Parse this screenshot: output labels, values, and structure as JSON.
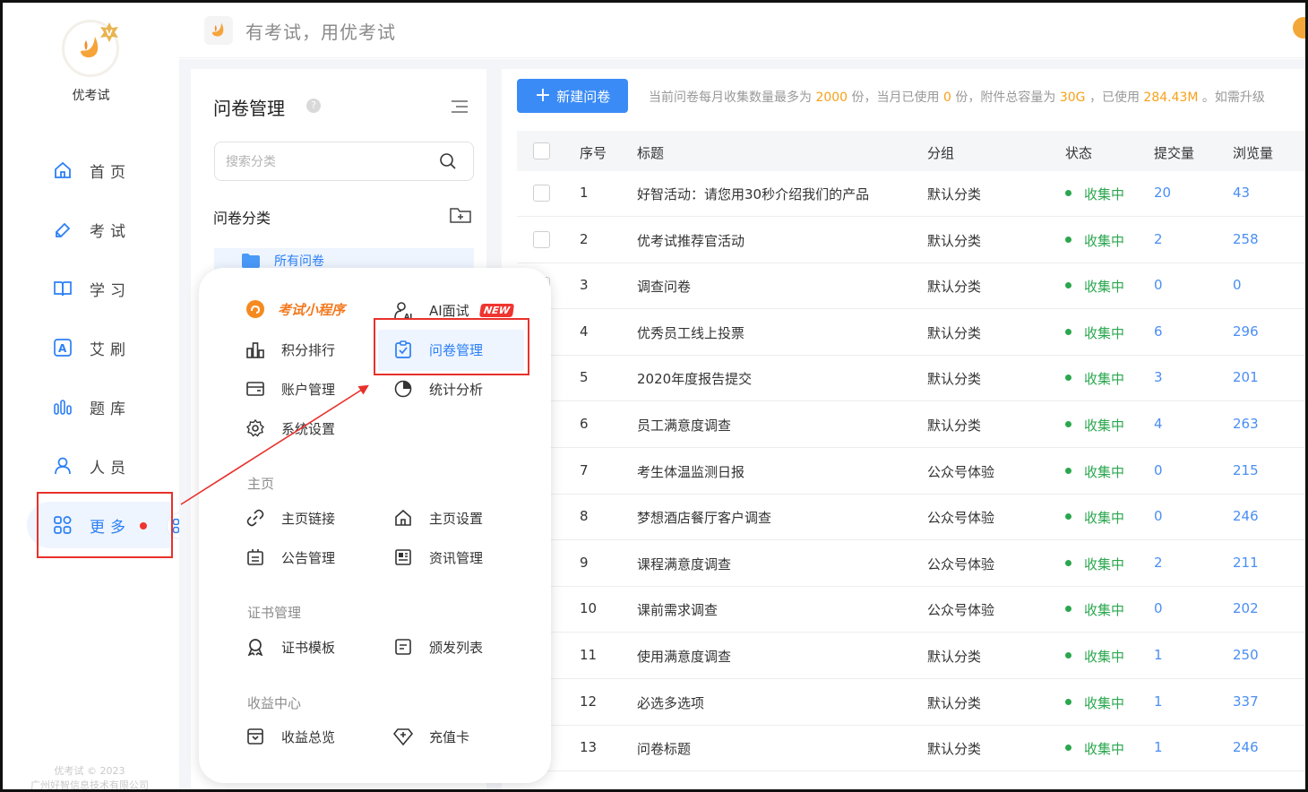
{
  "app": {
    "name": "优考试",
    "slogan": "有考试，用优考试"
  },
  "sidebar": {
    "items": [
      {
        "label": "首页",
        "icon": "home-icon"
      },
      {
        "label": "考试",
        "icon": "exam-icon"
      },
      {
        "label": "学习",
        "icon": "book-icon"
      },
      {
        "label": "艾刷",
        "icon": "ai-brush-icon"
      },
      {
        "label": "题库",
        "icon": "bank-icon"
      },
      {
        "label": "人员",
        "icon": "user-icon"
      },
      {
        "label": "更多",
        "icon": "grid-icon"
      }
    ],
    "copyright_line1": "优考试 © 2023",
    "copyright_line2": "广州好智信息技术有限公司"
  },
  "category_panel": {
    "title": "问卷管理",
    "help": "?",
    "search_placeholder": "搜索分类",
    "section_title": "问卷分类",
    "all_label": "所有问卷"
  },
  "main": {
    "new_button": "新建问卷",
    "info": {
      "p1": "当前问卷每月收集数量最多为 ",
      "v1": "2000",
      "p2": " 份，当月已使用 ",
      "v2": "0",
      "p3": " 份，附件总容量为 ",
      "v3": "30G",
      "p4": " ，已使用 ",
      "v4": "284.43M",
      "p5": " 。如需升级"
    },
    "columns": {
      "no": "序号",
      "title": "标题",
      "group": "分组",
      "status": "状态",
      "submits": "提交量",
      "views": "浏览量"
    },
    "rows": [
      {
        "no": "1",
        "title": "好智活动：请您用30秒介绍我们的产品",
        "group": "默认分类",
        "status": "收集中",
        "submits": "20",
        "views": "43"
      },
      {
        "no": "2",
        "title": "优考试推荐官活动",
        "group": "默认分类",
        "status": "收集中",
        "submits": "2",
        "views": "258"
      },
      {
        "no": "3",
        "title": "调查问卷",
        "group": "默认分类",
        "status": "收集中",
        "submits": "0",
        "views": "0"
      },
      {
        "no": "4",
        "title": "优秀员工线上投票",
        "group": "默认分类",
        "status": "收集中",
        "submits": "6",
        "views": "296"
      },
      {
        "no": "5",
        "title": "2020年度报告提交",
        "group": "默认分类",
        "status": "收集中",
        "submits": "3",
        "views": "201"
      },
      {
        "no": "6",
        "title": "员工满意度调查",
        "group": "默认分类",
        "status": "收集中",
        "submits": "4",
        "views": "263"
      },
      {
        "no": "7",
        "title": "考生体温监测日报",
        "group": "公众号体验",
        "status": "收集中",
        "submits": "0",
        "views": "215"
      },
      {
        "no": "8",
        "title": "梦想酒店餐厅客户调查",
        "group": "公众号体验",
        "status": "收集中",
        "submits": "0",
        "views": "246"
      },
      {
        "no": "9",
        "title": "课程满意度调查",
        "group": "公众号体验",
        "status": "收集中",
        "submits": "2",
        "views": "211"
      },
      {
        "no": "10",
        "title": "课前需求调查",
        "group": "公众号体验",
        "status": "收集中",
        "submits": "0",
        "views": "202"
      },
      {
        "no": "11",
        "title": "使用满意度调查",
        "group": "默认分类",
        "status": "收集中",
        "submits": "1",
        "views": "250"
      },
      {
        "no": "12",
        "title": "必选多选项",
        "group": "默认分类",
        "status": "收集中",
        "submits": "1",
        "views": "337"
      },
      {
        "no": "13",
        "title": "问卷标题",
        "group": "默认分类",
        "status": "收集中",
        "submits": "1",
        "views": "246"
      }
    ]
  },
  "popup": {
    "mini_program": "考试小程序",
    "ai_interview": "AI面试",
    "new_tag": "NEW",
    "points_rank": "积分排行",
    "survey_manage": "问卷管理",
    "account_manage": "账户管理",
    "stats": "统计分析",
    "system_settings": "系统设置",
    "sec_home": "主页",
    "home_link": "主页链接",
    "home_settings": "主页设置",
    "notice_manage": "公告管理",
    "news_manage": "资讯管理",
    "sec_cert": "证书管理",
    "cert_template": "证书模板",
    "issue_list": "颁发列表",
    "sec_income": "收益中心",
    "income_overview": "收益总览",
    "recharge_card": "充值卡"
  },
  "colors": {
    "accent": "#2b7ff5",
    "button": "#3b8bf7",
    "highlight": "#f7a11a",
    "status_green": "#2aa74e",
    "annotation_red": "#e8312b"
  }
}
